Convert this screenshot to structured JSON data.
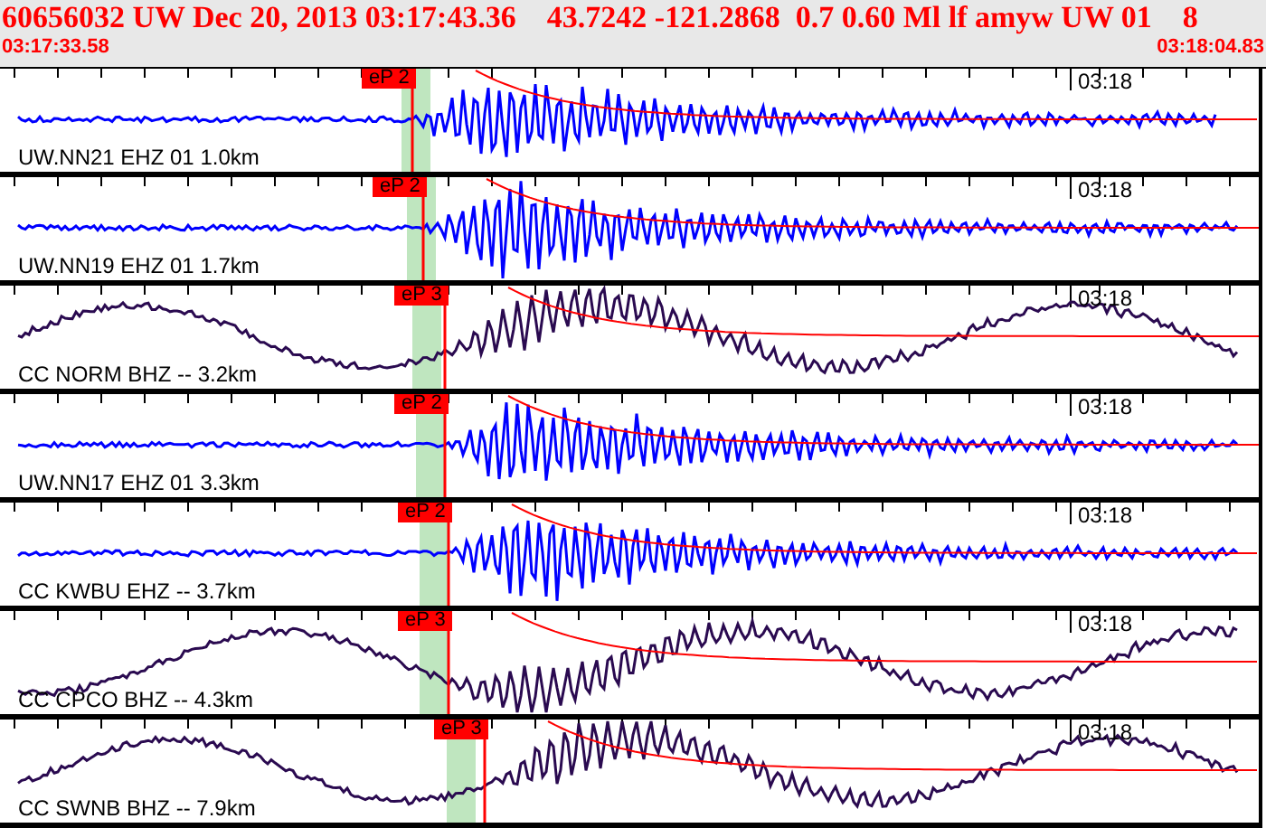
{
  "header": {
    "title": "60656032 UW Dec 20, 2013 03:17:43.36    43.7242 -121.2868  0.7 0.60 Ml lf amyw UW 01    8",
    "start_time": "03:17:33.58",
    "end_time": "03:18:04.83"
  },
  "traces": [
    {
      "label": "UW.NN21 EHZ 01 1.0km",
      "kind": "short-period",
      "color": "#0000ff",
      "pick": "eP 2",
      "tick_label": "03:18"
    },
    {
      "label": "UW.NN19 EHZ 01 1.7km",
      "kind": "short-period",
      "color": "#0000ff",
      "pick": "eP 2",
      "tick_label": "03:18"
    },
    {
      "label": "CC NORM BHZ -- 3.2km",
      "kind": "broadband",
      "color": "#2a0a50",
      "pick": "eP 3",
      "tick_label": "03:18"
    },
    {
      "label": "UW.NN17 EHZ 01 3.3km",
      "kind": "short-period",
      "color": "#0000ff",
      "pick": "eP 2",
      "tick_label": "03:18"
    },
    {
      "label": "CC KWBU EHZ -- 3.7km",
      "kind": "short-period",
      "color": "#0000ff",
      "pick": "eP 2",
      "tick_label": "03:18"
    },
    {
      "label": "CC CPCO BHZ -- 4.3km",
      "kind": "broadband",
      "color": "#2a0a50",
      "pick": "eP 3",
      "tick_label": "03:18"
    },
    {
      "label": "CC SWNB BHZ -- 7.9km",
      "kind": "broadband",
      "color": "#2a0a50",
      "pick": "eP 3",
      "tick_label": "03:18"
    }
  ]
}
